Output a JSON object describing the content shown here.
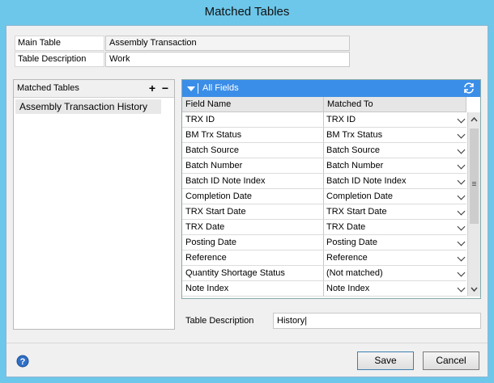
{
  "window": {
    "title": "Matched Tables"
  },
  "header": {
    "main_table_label": "Main Table",
    "main_table_value": "Assembly Transaction",
    "table_description_label": "Table Description",
    "table_description_value": "Work"
  },
  "left_panel": {
    "title": "Matched Tables",
    "add_label": "+",
    "remove_label": "−",
    "items": [
      "Assembly Transaction History"
    ]
  },
  "grid": {
    "filter_label": "All Fields",
    "columns": [
      "Field Name",
      "Matched To"
    ],
    "rows": [
      {
        "field": "TRX ID",
        "matched": "TRX ID"
      },
      {
        "field": "BM Trx Status",
        "matched": "BM Trx Status"
      },
      {
        "field": "Batch Source",
        "matched": "Batch Source"
      },
      {
        "field": "Batch Number",
        "matched": "Batch Number"
      },
      {
        "field": "Batch ID Note Index",
        "matched": "Batch ID Note Index"
      },
      {
        "field": "Completion Date",
        "matched": "Completion Date"
      },
      {
        "field": "TRX Start Date",
        "matched": "TRX Start Date"
      },
      {
        "field": "TRX Date",
        "matched": "TRX Date"
      },
      {
        "field": "Posting Date",
        "matched": "Posting Date"
      },
      {
        "field": "Reference",
        "matched": "Reference"
      },
      {
        "field": "Quantity Shortage Status",
        "matched": "(Not matched)"
      },
      {
        "field": "Note Index",
        "matched": "Note Index"
      }
    ],
    "scroll_fraction": 0.0
  },
  "detail": {
    "table_description_label": "Table Description",
    "table_description_value": "History|"
  },
  "footer": {
    "save_label": "Save",
    "cancel_label": "Cancel"
  },
  "colors": {
    "titlebar": "#6dc7ea",
    "grid_header": "#3b8ee8"
  }
}
